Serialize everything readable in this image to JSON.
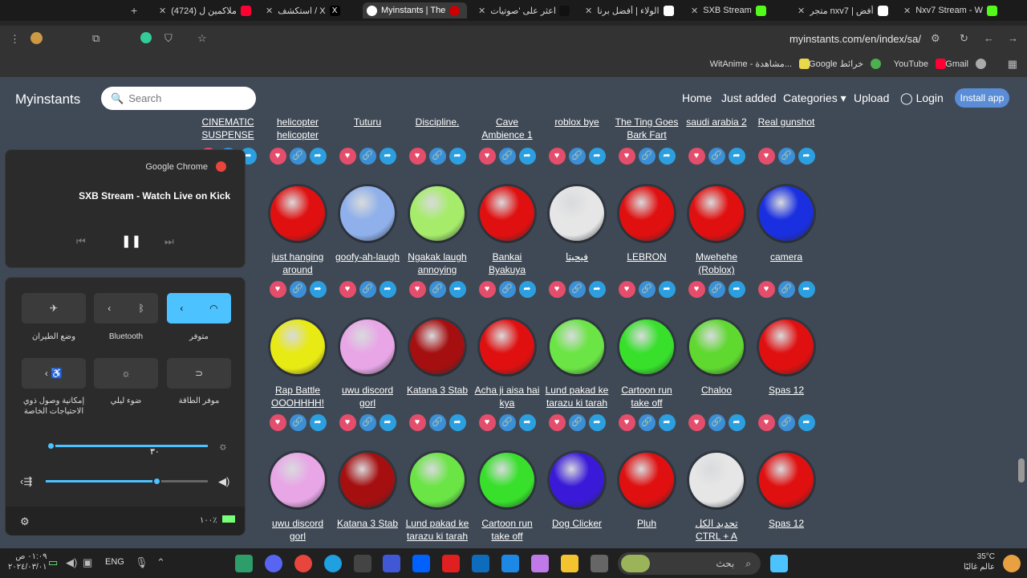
{
  "tabs": [
    {
      "title": "(4724) ملاكمين ل",
      "color": "#ff0033"
    },
    {
      "title": "استكشف / X",
      "color": "#000000"
    },
    {
      "title": "Myinstants | The",
      "color": "#cc0000"
    },
    {
      "title": "اعثر على 'صوتيات",
      "color": "#111111"
    },
    {
      "title": "الولاء | أفضل برنا",
      "color": "#ffffff"
    },
    {
      "title": "SXB Stream",
      "color": "#53fc18"
    },
    {
      "title": "متجر nxv7 | أفض",
      "color": "#ffffff"
    },
    {
      "title": "Nxv7 Stream - W",
      "color": "#53fc18"
    }
  ],
  "url": "myinstants.com/en/index/sa/",
  "bookmarks": [
    "WitAnime - مشاهدة...",
    "Google خرائط",
    "YouTube",
    "Gmail"
  ],
  "site": {
    "logo": "Myinstants",
    "search_placeholder": "Search",
    "nav": [
      "Home",
      "Just added",
      "Categories",
      "Upload",
      "Login"
    ],
    "install": "Install app"
  },
  "top_labels": [
    "CINEMATIC SUSPENSE",
    "helicopter helicopter",
    "Tuturu",
    "Discipline.",
    "Cave Ambience 1",
    "roblox bye",
    "The Ting Goes Bark Fart",
    "saudi arabia 2",
    "Real gunshot"
  ],
  "row1": [
    {
      "label": "just hanging around",
      "color": "#e01010"
    },
    {
      "label": "goofy-ah-laugh",
      "color": "#8fb0ea"
    },
    {
      "label": "Ngakak laugh annoying",
      "color": "#a6ec6a"
    },
    {
      "label": "Bankai Byakuya",
      "color": "#e01010"
    },
    {
      "label": "فيحيتا",
      "color": "#e6e6e6"
    },
    {
      "label": "LEBRON",
      "color": "#e01010"
    },
    {
      "label": "Mwehehe (Roblox)",
      "color": "#e01010"
    },
    {
      "label": "camera",
      "color": "#1a2fe0"
    }
  ],
  "row2": [
    {
      "label": "Rap Battle OOOHHHH!",
      "color": "#e8ea14"
    },
    {
      "label": "uwu discord gorl",
      "color": "#e8a6e6"
    },
    {
      "label": "Katana 3 Stab",
      "color": "#a50f10"
    },
    {
      "label": "Acha ji aisa hai kya",
      "color": "#e01010"
    },
    {
      "label": "Lund pakad ke tarazu ki tarah",
      "color": "#6be446"
    },
    {
      "label": "Cartoon run take off",
      "color": "#38e02c"
    },
    {
      "label": "Chaloo",
      "color": "#5fd830"
    },
    {
      "label": "Spas 12",
      "color": "#e01010"
    }
  ],
  "row3": [
    {
      "label": "uwu discord gorl",
      "color": "#e8a6e6"
    },
    {
      "label": "Katana 3 Stab",
      "color": "#a50f10"
    },
    {
      "label": "Lund pakad ke tarazu ki tarah",
      "color": "#6be446"
    },
    {
      "label": "Cartoon run take off",
      "color": "#38e02c"
    },
    {
      "label": "Dog Clicker",
      "color": "#3a1ad8"
    },
    {
      "label": "Pluh",
      "color": "#e01010"
    },
    {
      "label": "تحديد الكل CTRL + A",
      "color": "#e6e6e6"
    },
    {
      "label": "Spas 12",
      "color": "#e01010"
    }
  ],
  "media": {
    "source": "Google Chrome",
    "title": "SXB Stream - Watch Live on Kick"
  },
  "quick": [
    {
      "label": "وضع الطيران"
    },
    {
      "label": "Bluetooth"
    },
    {
      "label": "متوفر"
    },
    {
      "label": "إمكانية وصول ذوي الاحتياجات الخاصة"
    },
    {
      "label": "ضوء ليلي"
    },
    {
      "label": "موفر الطاقة"
    }
  ],
  "brightness": "٣٠",
  "battery": "١٠٠٪",
  "taskbar": {
    "time": "٠١:٠٩ ص",
    "date": "٢٠٢٤/٠٣/٠١",
    "lang": "ENG",
    "search": "بحث",
    "temp": "35°C",
    "weather": "عالم غالبًا"
  }
}
